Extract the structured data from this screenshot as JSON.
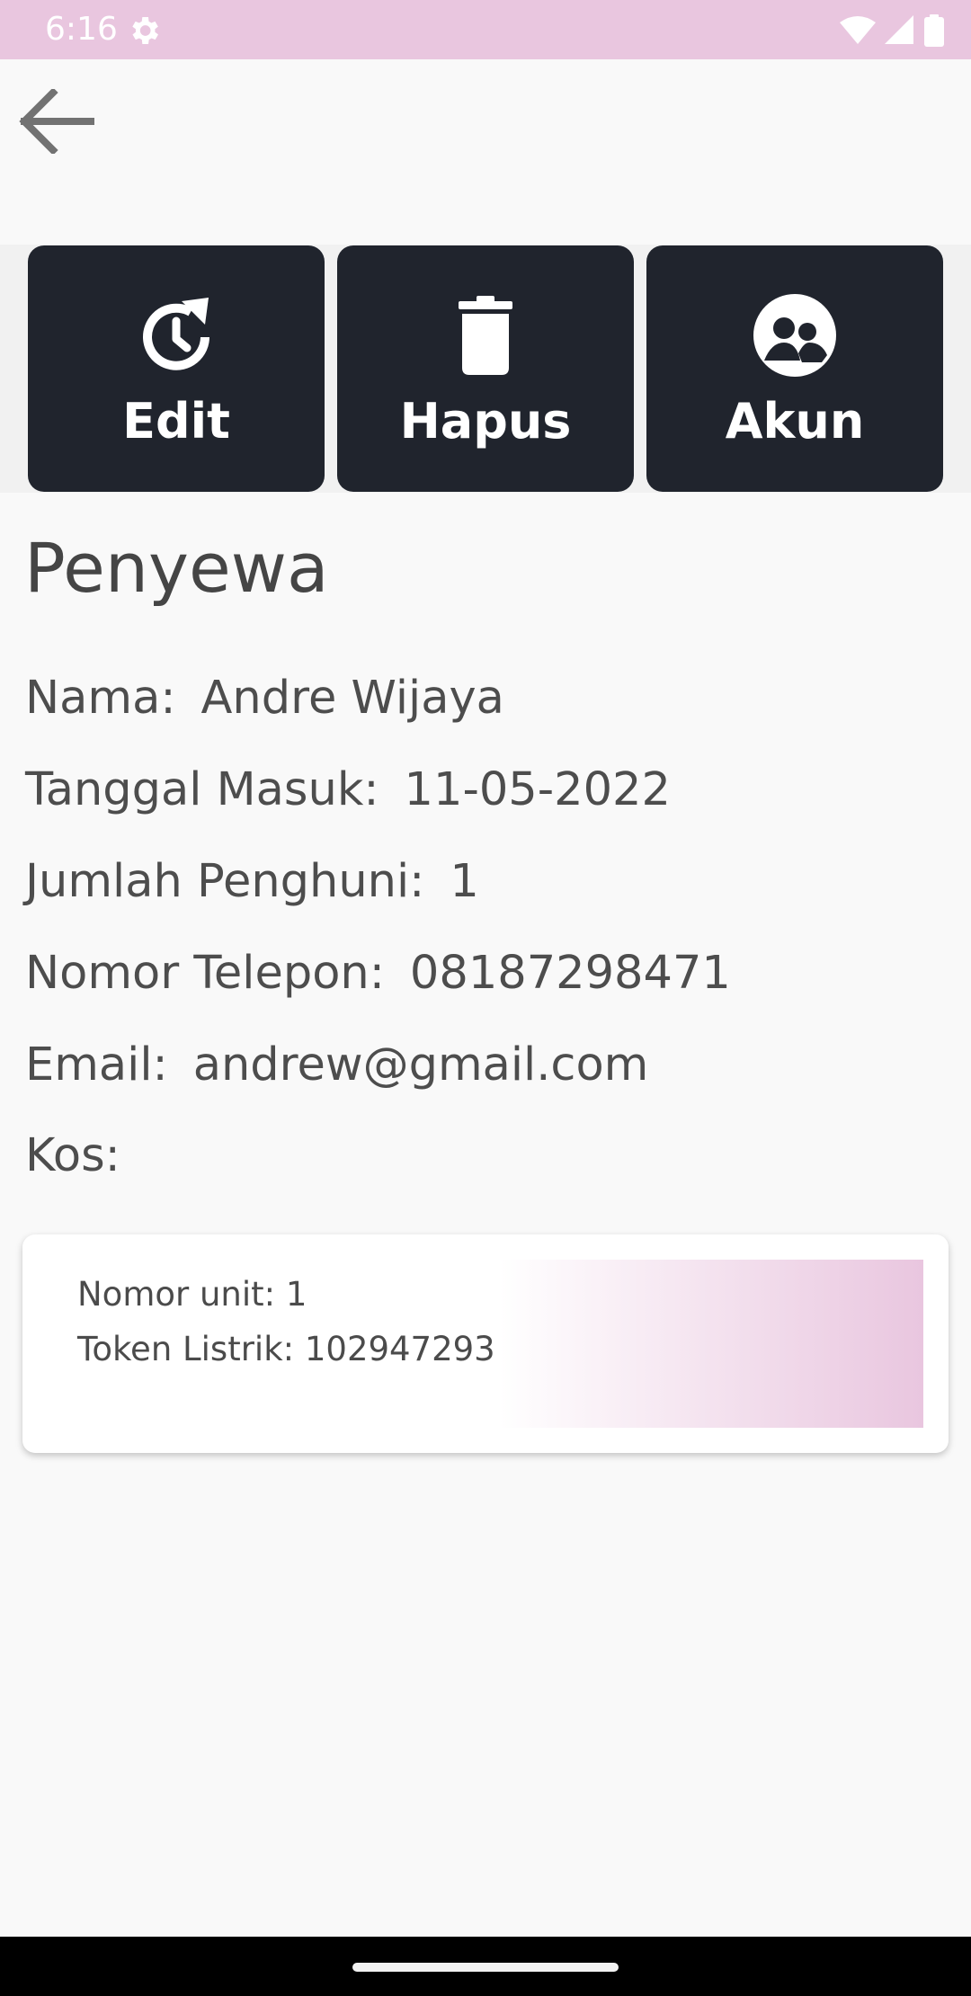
{
  "status_bar": {
    "time": "6:16",
    "background": "#e9c6df",
    "icons": [
      "gear-icon",
      "wifi-icon",
      "signal-icon",
      "battery-icon"
    ]
  },
  "toolbar": {
    "back_icon": "arrow-left-icon"
  },
  "actions": {
    "edit_label": "Edit",
    "edit_icon": "history-clock-icon",
    "delete_label": "Hapus",
    "delete_icon": "trash-icon",
    "account_label": "Akun",
    "account_icon": "people-circle-icon",
    "button_color": "#20242d"
  },
  "page": {
    "title": "Penyewa"
  },
  "details": {
    "nama_label": "Nama:",
    "nama_value": "Andre Wijaya",
    "tanggal_label": "Tanggal Masuk:",
    "tanggal_value": "11-05-2022",
    "jumlah_label": "Jumlah Penghuni:",
    "jumlah_value": "1",
    "telepon_label": "Nomor Telepon:",
    "telepon_value": "08187298471",
    "email_label": "Email:",
    "email_value": "andrew@gmail.com",
    "kos_label": "Kos:"
  },
  "kos_card": {
    "unit": "Nomor unit: 1",
    "token": "Token Listrik: 102947293",
    "accent": "#e9c6df"
  }
}
